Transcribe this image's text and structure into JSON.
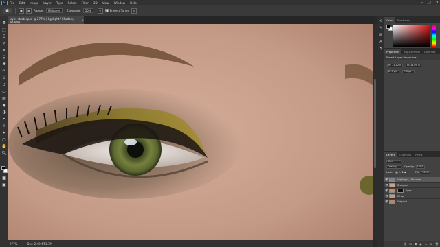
{
  "menu": [
    "File",
    "Edit",
    "Image",
    "Layer",
    "Type",
    "Select",
    "Filter",
    "3D",
    "View",
    "Window",
    "Help"
  ],
  "logo": "Ps",
  "window_controls": [
    "–",
    "▢",
    "✕"
  ],
  "options": {
    "range_label": "Range:",
    "range_value": "Midtones",
    "exposure_label": "Exposure:",
    "exposure_value": "50%",
    "protect_tones_label": "Protect Tones"
  },
  "document": {
    "tab_title": "eyes-starter.psd @ 277% (Highlight / Shadow, RGB/8)",
    "close_glyph": "×"
  },
  "status": {
    "zoom": "277%",
    "doc_size": "Doc: 2.49M/11.7M"
  },
  "panels": {
    "color_tabs": [
      "Color",
      "Swatches"
    ],
    "props_tabs": [
      "Properties",
      "Adjustments",
      "Libraries"
    ],
    "props_title": "Smart Layer Properties",
    "props_w": "W: 21.12 in",
    "props_h": "H: 14.09 in",
    "props_x": "X: 0 px",
    "props_y": "Y: 0 px",
    "layers_tabs": [
      "Layers",
      "Channels",
      "Paths"
    ],
    "kind_label": "Kind",
    "blend_mode": "Overlay",
    "opacity_label": "Opacity:",
    "opacity_value": "100%",
    "lock_label": "Lock:",
    "fill_label": "Fill:",
    "fill_value": "100%"
  },
  "layers": [
    {
      "name": "Highlight / Shadow",
      "selected": true
    },
    {
      "name": "Sharpen",
      "selected": false
    },
    {
      "name": "Eyes",
      "selected": false
    },
    {
      "name": "Wrap",
      "selected": false
    },
    {
      "name": "Original",
      "selected": false
    }
  ],
  "colors": {
    "accent": "#31a8ff",
    "skin": "#c9a08c",
    "iris": "#6b7a3c",
    "eyeshadow_gold": "#8a7a2a"
  }
}
